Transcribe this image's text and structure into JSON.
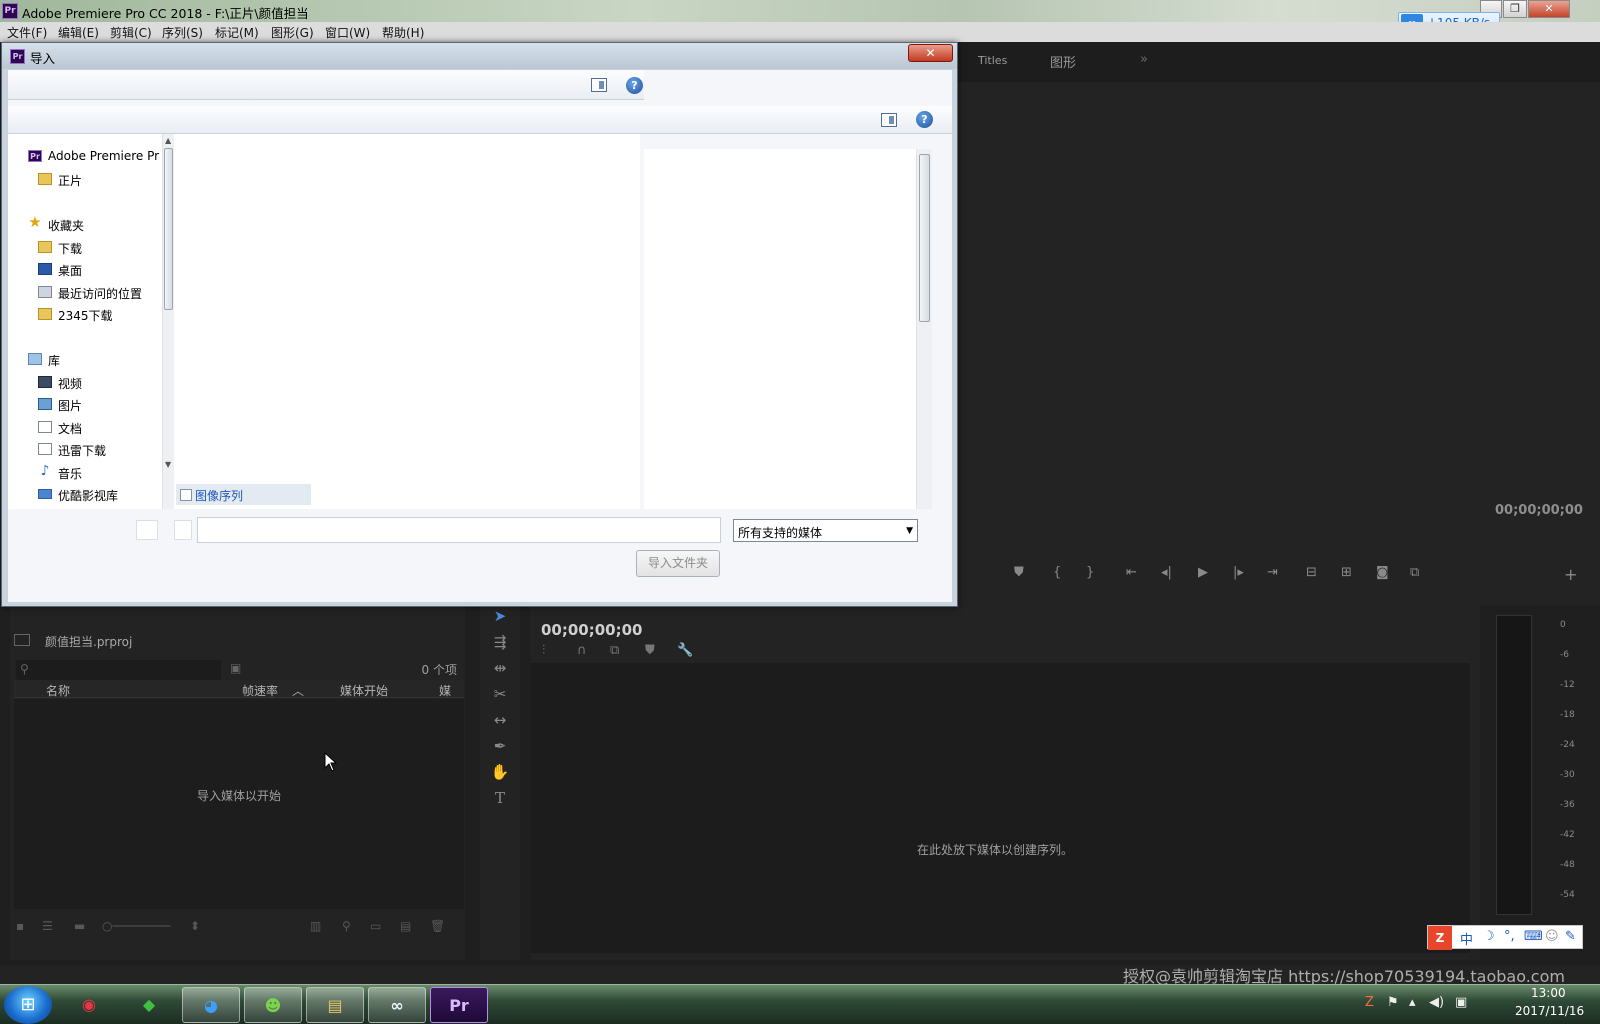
{
  "window": {
    "title": "Adobe Premiere Pro CC 2018 - F:\\正片\\颜值担当",
    "app_icon": "Pr",
    "controls": [
      "minimize-icon",
      "maximize-icon",
      "close-icon"
    ]
  },
  "net_widget": {
    "rate": "↓105 KB/s"
  },
  "menu": [
    "文件(F)",
    "编辑(E)",
    "剪辑(C)",
    "序列(S)",
    "标记(M)",
    "图形(G)",
    "窗口(W)",
    "帮助(H)"
  ],
  "workspace_tabs": [
    "Titles",
    "图形",
    "»"
  ],
  "program_monitor": {
    "timecode": "00;00;00;00",
    "transport_icons": [
      "marker-icon",
      "in-point-icon",
      "out-point-icon",
      "go-to-in-icon",
      "step-back-icon",
      "play-icon",
      "step-forward-icon",
      "go-to-out-icon",
      "lift-icon",
      "extract-icon",
      "export-frame-icon",
      "comparison-icon",
      "add-button-icon"
    ]
  },
  "import_dialog": {
    "title": "导入",
    "nav_items": [
      {
        "label": "Adobe Premiere Pr",
        "icon": "premiere-icon"
      },
      {
        "label": "正片",
        "icon": "folder-icon"
      },
      {
        "label": "收藏夹",
        "icon": "star-icon"
      },
      {
        "label": "下载",
        "icon": "download-folder-icon"
      },
      {
        "label": "桌面",
        "icon": "desktop-icon"
      },
      {
        "label": "最近访问的位置",
        "icon": "recent-places-icon"
      },
      {
        "label": "2345下载",
        "icon": "folder-icon"
      },
      {
        "label": "库",
        "icon": "library-icon"
      },
      {
        "label": "视频",
        "icon": "video-library-icon"
      },
      {
        "label": "图片",
        "icon": "picture-library-icon"
      },
      {
        "label": "文档",
        "icon": "document-library-icon"
      },
      {
        "label": "迅雷下载",
        "icon": "thunder-download-icon"
      },
      {
        "label": "音乐",
        "icon": "music-icon"
      },
      {
        "label": "优酷影视库",
        "icon": "youku-library-icon"
      }
    ],
    "image_sequence_label": "图像序列",
    "filetype_value": "所有支持的媒体",
    "import_folder_button": "导入文件夹",
    "filename_value": ""
  },
  "project_panel": {
    "project_name": "颜值担当.prproj",
    "item_count": "0 个项",
    "columns": [
      "名称",
      "帧速率",
      "媒体开始",
      "媒"
    ],
    "empty_message": "导入媒体以开始"
  },
  "timeline": {
    "timecode": "00;00;00;00",
    "empty_message": "在此处放下媒体以创建序列。"
  },
  "audio_meter_labels": [
    "0",
    "-6",
    "-12",
    "-18",
    "-24",
    "-30",
    "-36",
    "-42",
    "-48",
    "-54"
  ],
  "ime": {
    "items": [
      "中",
      "☽",
      "°,",
      "⌨",
      "☺",
      "✎"
    ]
  },
  "watermark": "授权@袁帅剪辑淘宝店  https://shop70539194.taobao.com",
  "taskbar": {
    "apps": [
      "start-icon",
      "media-player-icon",
      "green-app-icon",
      "qq-bird-icon",
      "pig-app-icon",
      "explorer-icon",
      "baidu-cloud-icon",
      "premiere-icon"
    ],
    "clock_time": "13:00",
    "clock_date": "2017/11/16"
  }
}
